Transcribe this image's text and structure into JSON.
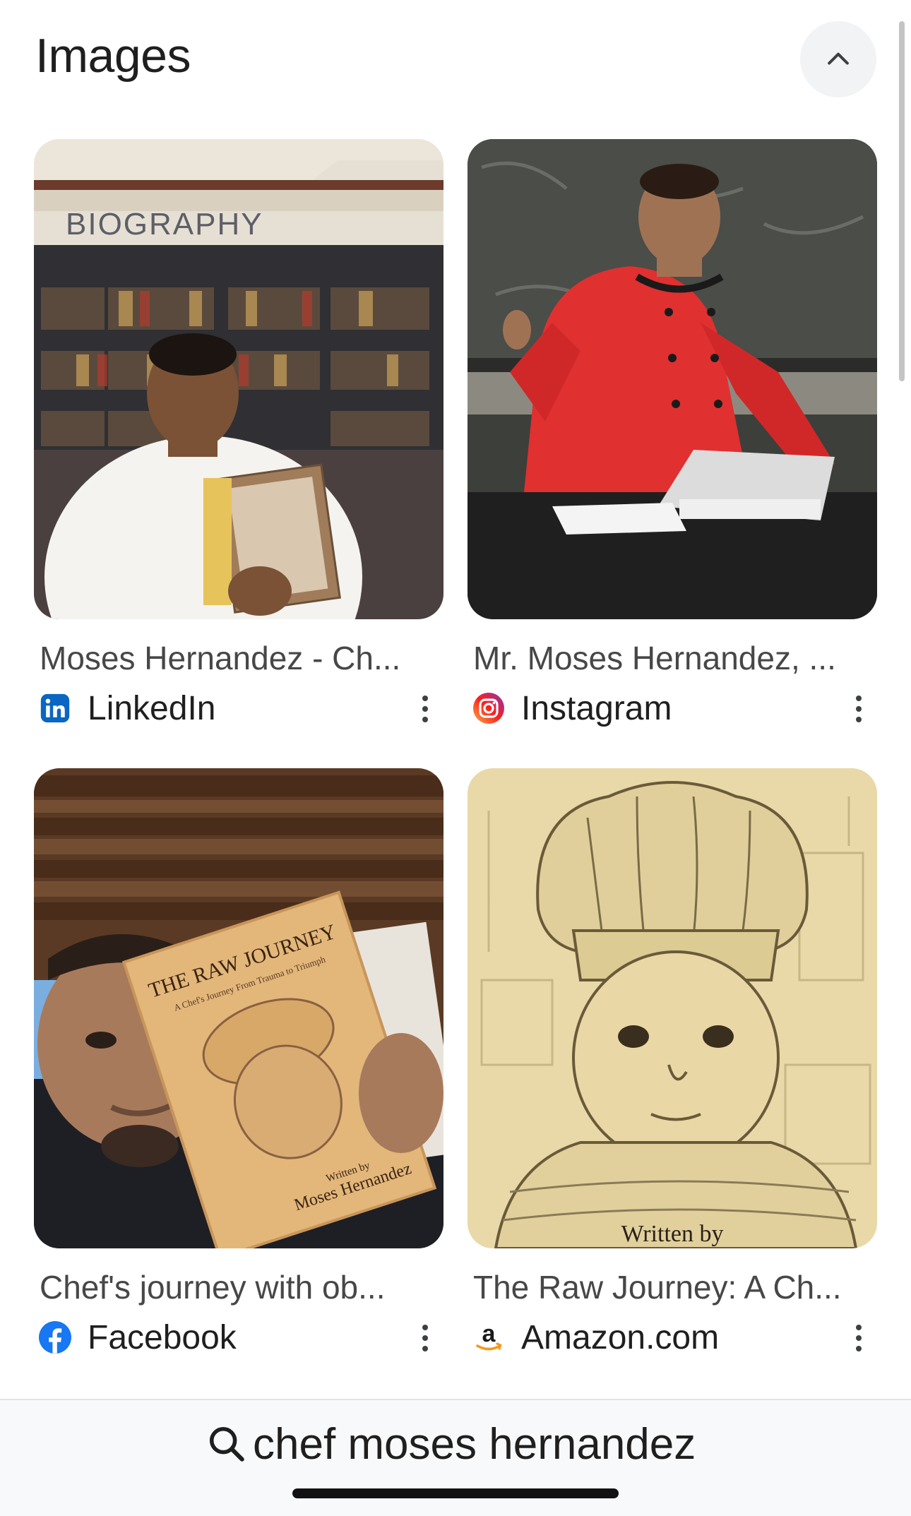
{
  "section": {
    "title": "Images",
    "collapse_icon": "chevron-up-icon"
  },
  "images": [
    {
      "title": "Moses Hernandez - Ch...",
      "source": "LinkedIn",
      "source_icon": "linkedin-icon",
      "thumb_text": "BIOGRAPHY"
    },
    {
      "title": "Mr. Moses Hernandez, ...",
      "source": "Instagram",
      "source_icon": "instagram-icon"
    },
    {
      "title": "Chef's journey with ob...",
      "source": "Facebook",
      "source_icon": "facebook-icon",
      "book_title": "THE RAW JOURNEY",
      "book_subtitle": "A Chef's Journey From Trauma to Triumph",
      "book_author_line1": "Written by",
      "book_author_line2": "Moses Hernandez"
    },
    {
      "title": "The Raw Journey: A Ch...",
      "source": "Amazon.com",
      "source_icon": "amazon-icon",
      "thumb_text": "Written by"
    }
  ],
  "search": {
    "query": "chef moses hernandez",
    "icon": "search-icon"
  },
  "colors": {
    "linkedin": "#0a66c2",
    "facebook": "#1877f2",
    "chip_bg": "#f1f3f4"
  }
}
